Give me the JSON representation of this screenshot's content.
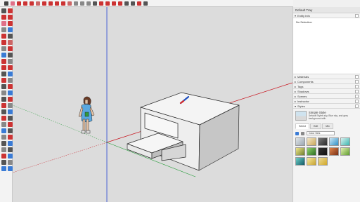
{
  "panel": {
    "title": "Default Tray",
    "entity_info": {
      "label": "Entity Info",
      "value": "No Selection"
    },
    "trays": [
      "Materials",
      "Components",
      "Tags",
      "Shadows",
      "Scenes",
      "Instructor"
    ],
    "styles": {
      "label": "Styles",
      "current_name": "Simple Style",
      "current_desc": "Default Styles sky, Blue sky, and grey background with",
      "tabs": [
        "Select",
        "Edit",
        "Mix"
      ],
      "library": "Color Sets"
    }
  },
  "colors": {
    "axis_red": "#c8141e",
    "axis_green": "#1e9a32",
    "axis_blue": "#2846d2",
    "person_dress": "#5aa8e0"
  }
}
